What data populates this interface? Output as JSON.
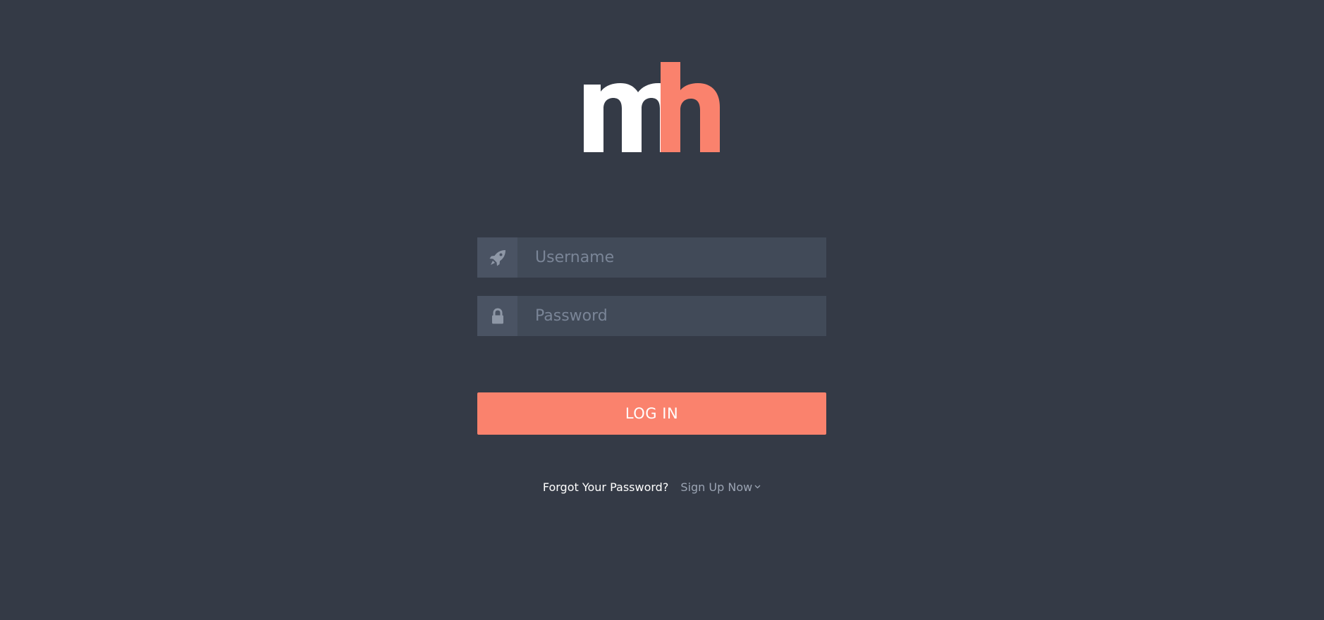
{
  "colors": {
    "background": "#343a46",
    "input_background": "#414a58",
    "icon_box_background": "#4a5363",
    "accent": "#fa826d",
    "logo_m": "#ffffff",
    "logo_h": "#fa826d"
  },
  "logo": {
    "text": "mh",
    "icon": "mh-logo"
  },
  "username": {
    "placeholder": "Username",
    "value": "",
    "icon": "rocket-icon"
  },
  "password": {
    "placeholder": "Password",
    "value": "",
    "icon": "lock-icon"
  },
  "login": {
    "label": "LOG IN"
  },
  "links": {
    "forgot": "Forgot Your Password?",
    "signup": "Sign Up Now",
    "signup_icon": "chevron-down-icon"
  }
}
